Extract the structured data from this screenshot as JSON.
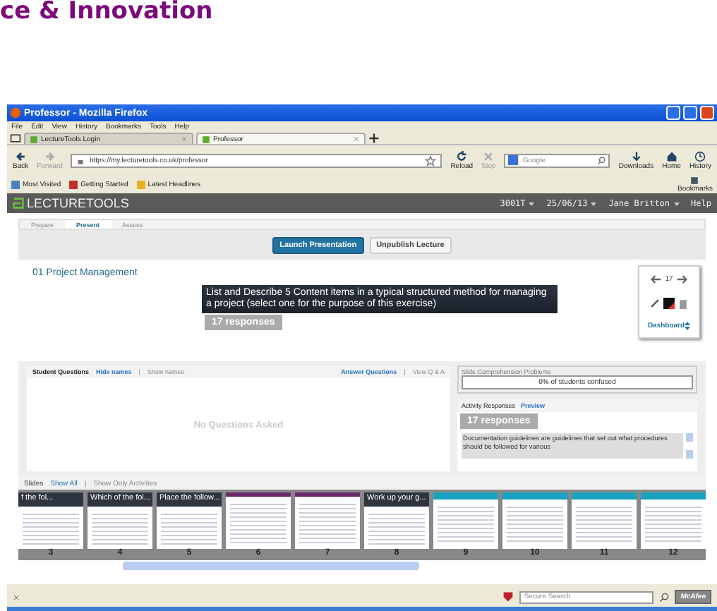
{
  "heading": "ce & Innovation",
  "window": {
    "title": "Professor - Mozilla Firefox"
  },
  "menu": [
    "File",
    "Edit",
    "View",
    "History",
    "Bookmarks",
    "Tools",
    "Help"
  ],
  "tabs": [
    {
      "label": "LectureTools Login",
      "selected": false
    },
    {
      "label": "Professor",
      "selected": true
    }
  ],
  "nav": {
    "back": {
      "label": "Back",
      "disabled": false
    },
    "forward": {
      "label": "Forward",
      "disabled": true
    },
    "url": "https://my.lecturetools.co.uk/professor",
    "reload": {
      "label": "Reload",
      "disabled": false
    },
    "stop": {
      "label": "Stop",
      "disabled": true
    },
    "search_placeholder": "Google",
    "downloads": "Downloads",
    "home": "Home",
    "history": "History"
  },
  "bookmarks": [
    "Most Visited",
    "Getting Started",
    "Latest Headlines"
  ],
  "bookmarks_button": "Bookmarks",
  "app": {
    "logo": "LECTURETOOLS",
    "menus": [
      "3001T",
      "25/06/13",
      "Jane Britton"
    ],
    "help": "Help"
  },
  "page_tabs": [
    {
      "label": "Prepare",
      "selected": false
    },
    {
      "label": "Present",
      "selected": true
    },
    {
      "label": "Assess",
      "selected": false
    }
  ],
  "actions": [
    {
      "label": "Launch Presentation",
      "kind": "primary"
    },
    {
      "label": "Unpublish Lecture",
      "kind": "secondary"
    }
  ],
  "lecture_title": "01 Project Management",
  "question": {
    "text": "List and Describe 5 Content items in a typical structured method for managing a project (select one for the purpose of this exercise)",
    "responses": "17 responses"
  },
  "slide_nav": {
    "number": "17",
    "dashboard": "Dashboard"
  },
  "student_questions": {
    "title": "Student Questions",
    "hide": "Hide names",
    "sep1": "|",
    "show": "Show names",
    "answer": "Answer Questions",
    "sep2": "|",
    "view": "View Q & A",
    "empty": "No Questions Asked"
  },
  "comprehension": {
    "title": "Slide Comprehension Problems",
    "value": "0% of students confused"
  },
  "activity": {
    "title": "Activity Responses",
    "preview": "Preview",
    "responses": "17 responses",
    "answer": "Documentation guidelines are guidelines that set out what procedures should be followed for various"
  },
  "slides": {
    "title": "Slides",
    "show_all": "Show All",
    "sep": "|",
    "show_activities": "Show Only Activities",
    "items": [
      {
        "number": "3",
        "kind": "question",
        "title": "f the fol..."
      },
      {
        "number": "4",
        "kind": "question",
        "title": "Which of the fol..."
      },
      {
        "number": "5",
        "kind": "question",
        "title": "Place the follow..."
      },
      {
        "number": "6",
        "kind": "content"
      },
      {
        "number": "7",
        "kind": "content"
      },
      {
        "number": "8",
        "kind": "question",
        "title": "Work up your g..."
      },
      {
        "number": "9",
        "kind": "teal"
      },
      {
        "number": "10",
        "kind": "teal"
      },
      {
        "number": "11",
        "kind": "teal"
      },
      {
        "number": "12",
        "kind": "teal"
      }
    ]
  },
  "status": {
    "search_placeholder": "Secure Search",
    "mcafee": "McAfee"
  }
}
